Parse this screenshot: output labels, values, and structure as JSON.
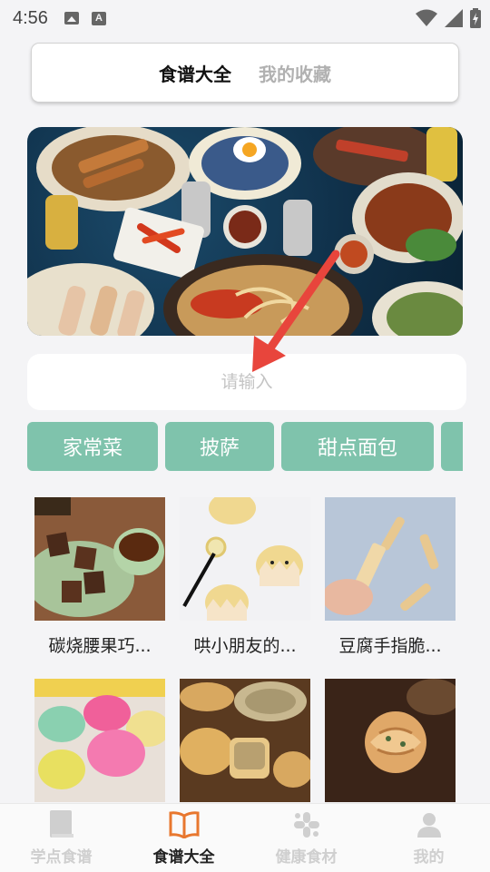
{
  "status_bar": {
    "time": "4:56",
    "letter_icon": "A"
  },
  "segment": {
    "tabs": [
      {
        "label": "食谱大全",
        "active": true
      },
      {
        "label": "我的收藏",
        "active": false
      }
    ]
  },
  "banner": {
    "icon": "food-spread-photo"
  },
  "search": {
    "placeholder": "请输入",
    "value": ""
  },
  "categories": [
    "家常菜",
    "披萨",
    "甜点面包"
  ],
  "recipes": [
    {
      "title": "碳烧腰果巧..."
    },
    {
      "title": "哄小朋友的..."
    },
    {
      "title": "豆腐手指脆..."
    },
    {
      "title": ""
    },
    {
      "title": ""
    },
    {
      "title": ""
    }
  ],
  "bottom_nav": [
    {
      "label": "学点食谱",
      "icon": "book-icon",
      "active": false
    },
    {
      "label": "食谱大全",
      "icon": "open-book-icon",
      "active": true
    },
    {
      "label": "健康食材",
      "icon": "grid-icon",
      "active": false
    },
    {
      "label": "我的",
      "icon": "person-icon",
      "active": false
    }
  ],
  "colors": {
    "accent": "#7fc3ac",
    "active_icon": "#e8772e",
    "arrow": "#e8453c"
  }
}
